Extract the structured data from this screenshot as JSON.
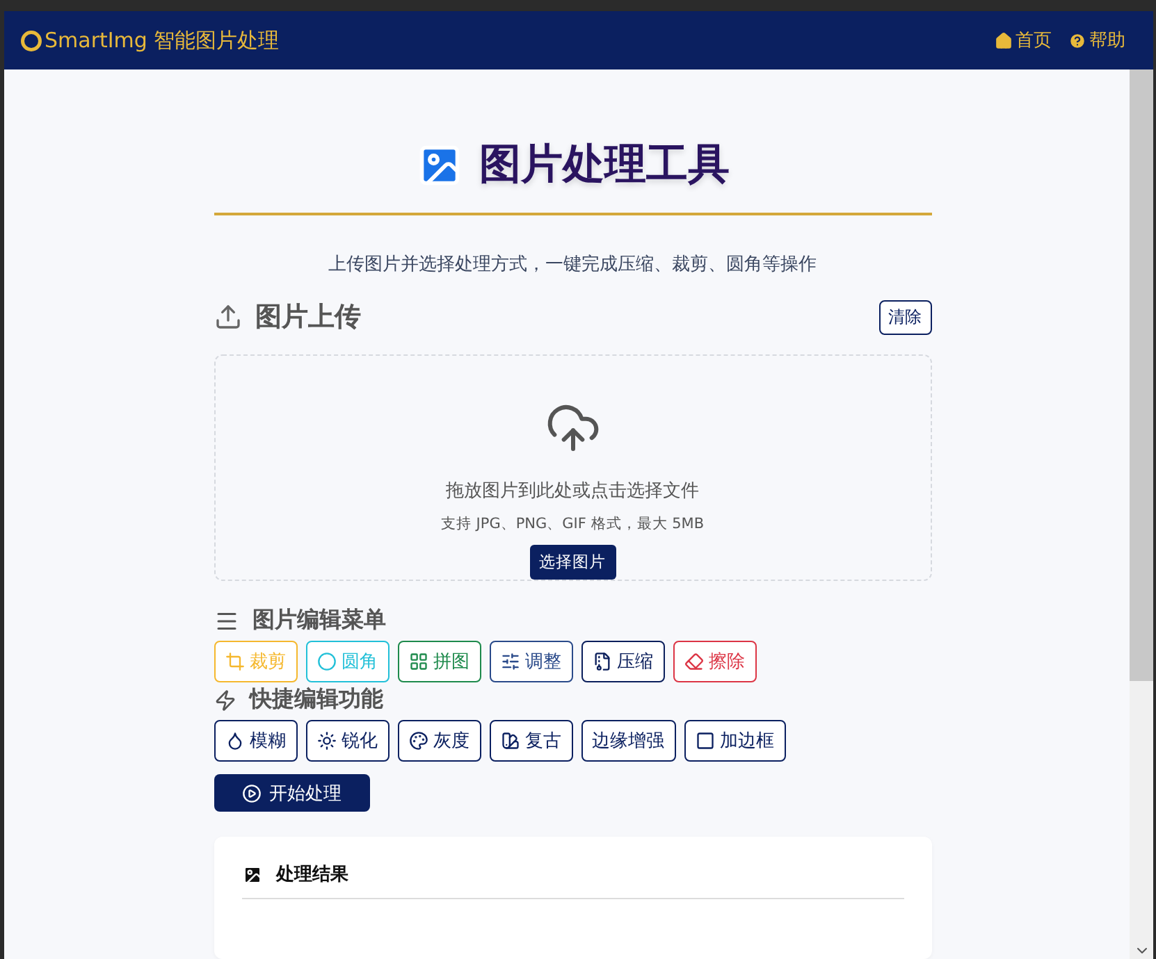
{
  "navbar": {
    "brand": "SmartImg 智能图片处理",
    "links": [
      "首页",
      "帮助"
    ]
  },
  "header": {
    "title": "图片处理工具",
    "subtitle": "上传图片并选择处理方式，一键完成压缩、裁剪、圆角等操作"
  },
  "upload": {
    "title": "图片上传",
    "clear_button": "清除",
    "drop_text": "拖放图片到此处或点击选择文件",
    "hint": "支持 JPG、PNG、GIF 格式，最大 5MB",
    "choose_button": "选择图片"
  },
  "edit_menu": {
    "title": "图片编辑菜单",
    "items": [
      {
        "label": "裁剪",
        "color": "#f5b82e"
      },
      {
        "label": "圆角",
        "color": "#22c0d8"
      },
      {
        "label": "拼图",
        "color": "#1e8a4c"
      },
      {
        "label": "调整",
        "color": "#2a4a8a"
      },
      {
        "label": "压缩",
        "color": "#0b1f5c"
      },
      {
        "label": "擦除",
        "color": "#dc3545"
      }
    ]
  },
  "quick_edit": {
    "title": "快捷编辑功能",
    "items": [
      "模糊",
      "锐化",
      "灰度",
      "复古",
      "边缘增强",
      "加边框"
    ]
  },
  "start_button": "开始处理",
  "result": {
    "title": "处理结果"
  }
}
